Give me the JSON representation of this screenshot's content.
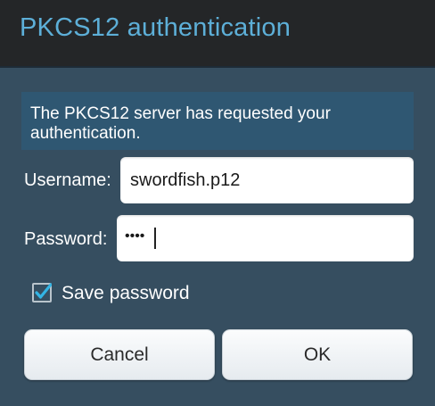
{
  "dialog": {
    "title": "PKCS12 authentication",
    "message": "The PKCS12 server has requested your authentication.",
    "username": {
      "label": "Username:",
      "value": "swordfish.p12"
    },
    "password": {
      "label": "Password:",
      "masked_value": "••••"
    },
    "save_password": {
      "label": "Save password",
      "checked": true
    },
    "buttons": {
      "cancel": "Cancel",
      "ok": "OK"
    }
  },
  "colors": {
    "title_text": "#5dafd8",
    "title_bar": "#242628",
    "body_background": "#364e60",
    "message_background": "#2f5772",
    "checkbox_accent": "#33b5e5"
  },
  "icons": {
    "save_password_checkbox": "checkmark-icon"
  }
}
